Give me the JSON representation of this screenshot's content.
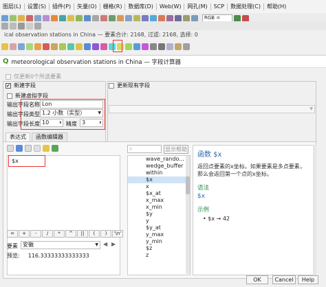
{
  "menubar": {
    "items": [
      "图层(L)",
      "设置(S)",
      "插件(P)",
      "矢量(O)",
      "栅格(R)",
      "数据库(D)",
      "Web(W)",
      "网孔(M)",
      "SCP",
      "数据处理(C)",
      "帮助(H)"
    ]
  },
  "toolbar": {
    "band_label": "RGB ="
  },
  "window_subtitle": "ical observation stations in China — 要素合计: 2168, 过滤: 2168, 选择: 0",
  "dialog": {
    "title": "meteorological observation stations in China — 字段计算器",
    "only_selected_label": "仅更新0个所选要素",
    "new_field_label": "新建字段",
    "update_field_label": "更新现有字段",
    "virtual_field_label": "新建虚拟字段",
    "name_label": "输出字段名称",
    "name_value": "Lon",
    "type_label": "输出字段类型",
    "type_value": "1.2 小数（实型）",
    "length_label": "输出字段长度",
    "length_value": "10",
    "precision_label": "精度",
    "precision_value": "3",
    "tabs": [
      "表达式",
      "函数编辑器"
    ],
    "expression": "$x",
    "operators": [
      "=",
      "+",
      "-",
      "/",
      "*",
      "^",
      "||",
      "(",
      ")",
      "'\\n'"
    ],
    "feature_label": "要素",
    "feature_value": "安徽",
    "preview_label": "预览:",
    "preview_value": "116.33333333333333",
    "search_placeholder": "",
    "show_help_label": "显示帮助",
    "function_list": [
      "wave_rando...",
      "wedge_buffer",
      "within",
      "$x",
      "x",
      "$x_at",
      "x_max",
      "x_min",
      "$y",
      "y",
      "$y_at",
      "y_max",
      "y_min",
      "$z",
      "z"
    ],
    "help": {
      "title": "函数 $x",
      "description": "返回点要素的x坐标。如果要素是多点要素，那么会返回第一个点的x坐标。",
      "syntax_heading": "语法",
      "syntax": "$x",
      "example_heading": "示例",
      "example": "$x → 42"
    },
    "buttons": {
      "ok": "OK",
      "cancel": "Cancel",
      "help": "Help"
    }
  }
}
